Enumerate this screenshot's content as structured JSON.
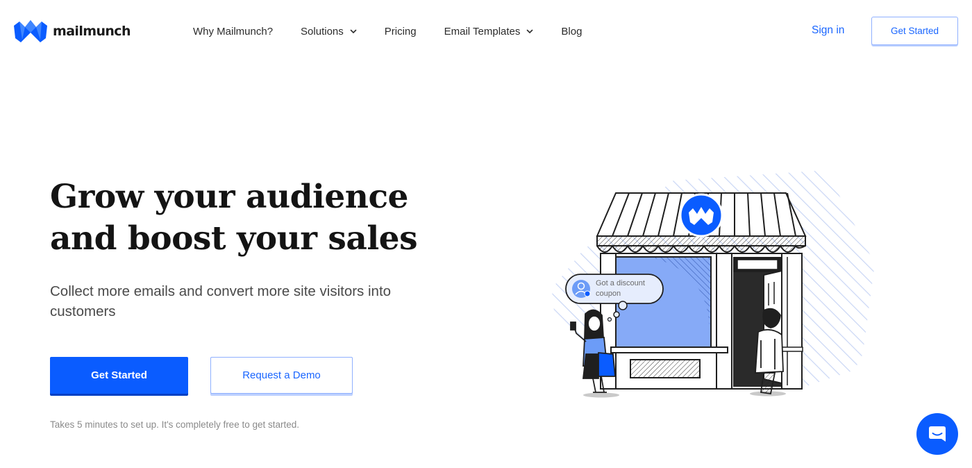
{
  "brand": {
    "name": "mailmunch",
    "primary_color": "#0a5cff",
    "link_color": "#1a66ff"
  },
  "nav": {
    "items": [
      {
        "label": "Why Mailmunch?",
        "has_dropdown": false
      },
      {
        "label": "Solutions",
        "has_dropdown": true
      },
      {
        "label": "Pricing",
        "has_dropdown": false
      },
      {
        "label": "Email Templates",
        "has_dropdown": true
      },
      {
        "label": "Blog",
        "has_dropdown": false
      }
    ],
    "sign_in": "Sign in",
    "cta": "Get Started"
  },
  "hero": {
    "title_line1": "Grow your audience",
    "title_line2": "and boost your sales",
    "subtitle": "Collect more emails and convert more site visitors into customers",
    "primary_button": "Get Started",
    "secondary_button": "Request a Demo",
    "note": "Takes 5 minutes to set up. It's completely free to get started."
  },
  "illustration": {
    "bubble_line1": "Got a discount",
    "bubble_line2": "coupon"
  },
  "icons": {
    "logo": "mailmunch-logo-icon",
    "chevron": "chevron-down-icon",
    "chat": "chat-launcher-icon"
  }
}
